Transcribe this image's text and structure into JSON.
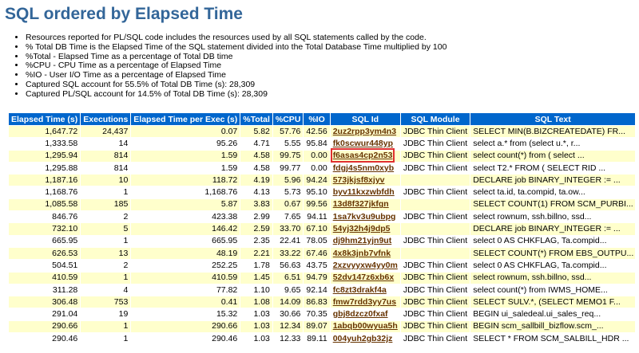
{
  "title": "SQL ordered by Elapsed Time",
  "notes": [
    "Resources reported for PL/SQL code includes the resources used by all SQL statements called by the code.",
    "% Total DB Time is the Elapsed Time of the SQL statement divided into the Total Database Time multiplied by 100",
    "%Total - Elapsed Time as a percentage of Total DB time",
    "%CPU - CPU Time as a percentage of Elapsed Time",
    "%IO - User I/O Time as a percentage of Elapsed Time",
    "Captured SQL account for 55.5% of Total DB Time (s): 28,309",
    "Captured PL/SQL account for 14.5% of Total DB Time (s): 28,309"
  ],
  "columns": [
    "Elapsed Time (s)",
    "Executions",
    "Elapsed Time per Exec (s)",
    "%Total",
    "%CPU",
    "%IO",
    "SQL Id",
    "SQL Module",
    "SQL Text"
  ],
  "rows": [
    [
      "1,647.72",
      "24,437",
      "0.07",
      "5.82",
      "57.76",
      "42.56",
      "2uz2rpp3ym4n3",
      "JDBC Thin Client",
      "SELECT MIN(B.BIZCREATEDATE) FR..."
    ],
    [
      "1,333.58",
      "14",
      "95.26",
      "4.71",
      "5.55",
      "95.84",
      "fk0scwur448yp",
      "JDBC Thin Client",
      "select a.* from (select u.*, r..."
    ],
    [
      "1,295.94",
      "814",
      "1.59",
      "4.58",
      "99.75",
      "0.00",
      "f6asas4cp2n53",
      "JDBC Thin Client",
      "select count(*) from ( select ..."
    ],
    [
      "1,295.88",
      "814",
      "1.59",
      "4.58",
      "99.77",
      "0.00",
      "fdgj4s5nm0xyb",
      "JDBC Thin Client",
      "select T2.* FROM ( SELECT RID ..."
    ],
    [
      "1,187.16",
      "10",
      "118.72",
      "4.19",
      "5.96",
      "94.24",
      "573jkjsf8xjyv",
      "",
      "DECLARE job BINARY_INTEGER := ..."
    ],
    [
      "1,168.76",
      "1",
      "1,168.76",
      "4.13",
      "5.73",
      "95.10",
      "byv11kxzwbfdh",
      "JDBC Thin Client",
      "select ta.id, ta.compid, ta.ow..."
    ],
    [
      "1,085.58",
      "185",
      "5.87",
      "3.83",
      "0.67",
      "99.56",
      "13d8f327jkfgn",
      "",
      "SELECT COUNT(1) FROM SCM_PURBI..."
    ],
    [
      "846.76",
      "2",
      "423.38",
      "2.99",
      "7.65",
      "94.11",
      "1sa7kv3u9ubpg",
      "JDBC Thin Client",
      "select rownum, ssh.billno, ssd..."
    ],
    [
      "732.10",
      "5",
      "146.42",
      "2.59",
      "33.70",
      "67.10",
      "54yj32h4j9dp5",
      "",
      "DECLARE job BINARY_INTEGER := ..."
    ],
    [
      "665.95",
      "1",
      "665.95",
      "2.35",
      "22.41",
      "78.05",
      "dj9hm21yjn9ut",
      "JDBC Thin Client",
      "select 0 AS CHKFLAG, Ta.compid..."
    ],
    [
      "626.53",
      "13",
      "48.19",
      "2.21",
      "33.22",
      "67.46",
      "4x8k3jnb7vfnk",
      "",
      "SELECT COUNT(*) FROM EBS_OUTPU..."
    ],
    [
      "504.51",
      "2",
      "252.25",
      "1.78",
      "56.63",
      "43.75",
      "2xzvyyxw4yy0m",
      "JDBC Thin Client",
      "select 0 AS CHKFLAG, Ta.compid..."
    ],
    [
      "410.59",
      "1",
      "410.59",
      "1.45",
      "6.51",
      "94.79",
      "52dv147z6xb6x",
      "JDBC Thin Client",
      "select rownum, ssh.billno, ssd..."
    ],
    [
      "311.28",
      "4",
      "77.82",
      "1.10",
      "9.65",
      "92.14",
      "fc8zt3drakf4a",
      "JDBC Thin Client",
      "select count(*) from IWMS_HOME..."
    ],
    [
      "306.48",
      "753",
      "0.41",
      "1.08",
      "14.09",
      "86.83",
      "fmw7rdd3yy7us",
      "JDBC Thin Client",
      "SELECT SULV.*, (SELECT MEMO1 F..."
    ],
    [
      "291.04",
      "19",
      "15.32",
      "1.03",
      "30.66",
      "70.35",
      "gbj8dzcz0fxaf",
      "JDBC Thin Client",
      "BEGIN ui_saledeal.ui_sales_req..."
    ],
    [
      "290.66",
      "1",
      "290.66",
      "1.03",
      "12.34",
      "89.07",
      "1abqb00wyua5h",
      "JDBC Thin Client",
      "BEGIN scm_sallbill_bizflow.scm_..."
    ],
    [
      "290.46",
      "1",
      "290.46",
      "1.03",
      "12.33",
      "89.11",
      "004yuh2gb32jz",
      "JDBC Thin Client",
      "SELECT * FROM SCM_SALBILL_HDR ..."
    ]
  ],
  "highlighted_sql_id": "f6asas4cp2n53",
  "colors": {
    "title": "#336699",
    "header_bg": "#0066cc",
    "odd_row": "#ffffcc",
    "link": "#663300",
    "highlight": "#e0302f"
  }
}
